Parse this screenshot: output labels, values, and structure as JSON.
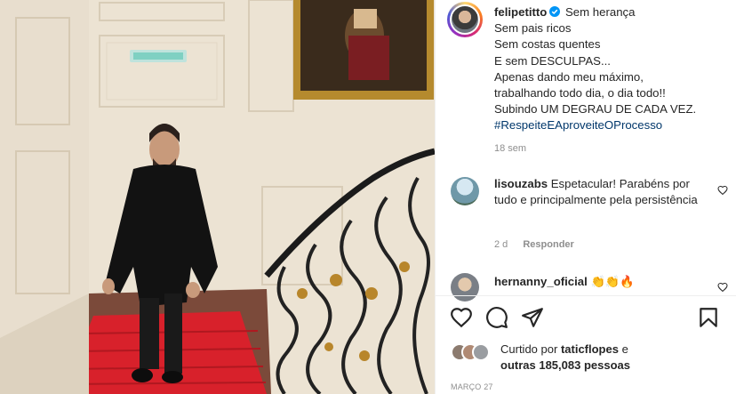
{
  "post": {
    "username": "felipetitto",
    "caption_lines": [
      "Sem herança",
      "Sem pais ricos",
      "Sem costas quentes",
      "E sem DESCULPAS...",
      "Apenas dando meu máximo,",
      "trabalhando todo dia, o dia todo!!",
      "Subindo UM DEGRAU DE CADA VEZ."
    ],
    "hashtag": "#RespeiteEAproveiteOProcesso",
    "time_ago": "18 sem"
  },
  "comments": [
    {
      "username": "lisouzabs",
      "text": "Espetacular! Parabéns por tudo e principalmente pela persistência",
      "time": "2 d",
      "reply_label": "Responder"
    },
    {
      "username": "hernanny_oficial",
      "text": "👏👏🔥"
    }
  ],
  "actions": {
    "like": "heart-icon",
    "comment": "comment-icon",
    "share": "share-icon",
    "save": "bookmark-icon"
  },
  "likes": {
    "prefix": "Curtido por",
    "user": "taticflopes",
    "conjunction": "e",
    "others": "outras 185,083 pessoas"
  },
  "date": "MARÇO 27",
  "colors": {
    "link": "#00376b",
    "muted": "#8e8e8e",
    "verified": "#0095f6",
    "carpet": "#d8212b"
  }
}
